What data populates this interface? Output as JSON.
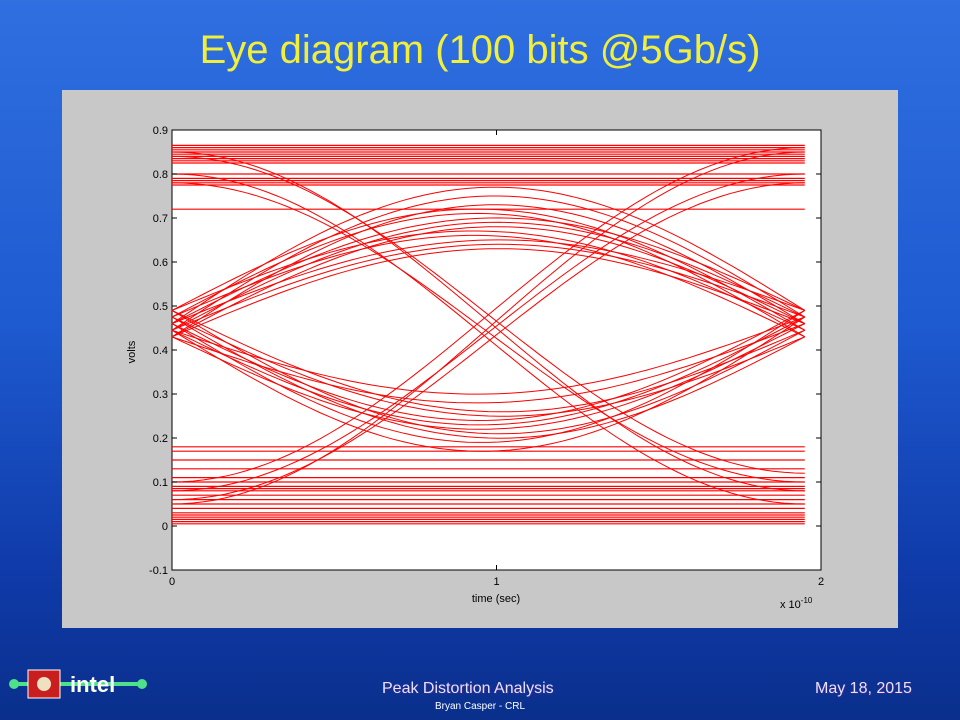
{
  "slide": {
    "title": "Eye diagram (100 bits @5Gb/s)",
    "footer_left": "Peak Distortion Analysis",
    "footer_right": "May 18, 2015",
    "author": "Bryan Casper - CRL",
    "logo_text": "intel"
  },
  "colors": {
    "title": "#f2ef3a",
    "trace": "#ff0000",
    "panel": "#c8c8c8"
  },
  "chart_data": {
    "type": "line",
    "title": "",
    "xlabel": "time (sec)",
    "ylabel": "volts",
    "x_exponent_label": "x 10",
    "x_exponent_power": "-10",
    "xlim": [
      0,
      2
    ],
    "ylim": [
      -0.1,
      0.9
    ],
    "xticks": [
      "0",
      "1",
      "2"
    ],
    "yticks": [
      "-0.1",
      "0",
      "0.1",
      "0.2",
      "0.3",
      "0.4",
      "0.5",
      "0.6",
      "0.7",
      "0.8",
      "0.9"
    ],
    "grid": false,
    "legend": "none",
    "series_color": "red",
    "x_end": 1.95,
    "crossing_level": 0.46,
    "eye_center_x": 1.0,
    "flat_high_levels": [
      0.72,
      0.775,
      0.78,
      0.785,
      0.79,
      0.8,
      0.825,
      0.83,
      0.835,
      0.84,
      0.845,
      0.85,
      0.855,
      0.86,
      0.865
    ],
    "flat_low_levels": [
      0.005,
      0.01,
      0.015,
      0.02,
      0.025,
      0.03,
      0.04,
      0.05,
      0.06,
      0.07,
      0.08,
      0.085,
      0.09,
      0.1,
      0.11,
      0.13,
      0.15,
      0.17,
      0.18
    ],
    "rising_peaks": [
      0.63,
      0.64,
      0.65,
      0.66,
      0.67,
      0.68,
      0.69,
      0.7,
      0.71,
      0.72,
      0.73,
      0.75,
      0.77
    ],
    "falling_troughs": [
      0.17,
      0.19,
      0.2,
      0.21,
      0.22,
      0.23,
      0.24,
      0.25,
      0.26,
      0.28,
      0.3
    ],
    "rising_cross_lines": [
      [
        0.05,
        0.85
      ],
      [
        0.08,
        0.8
      ],
      [
        0.1,
        0.86
      ],
      [
        0.06,
        0.78
      ]
    ],
    "falling_cross_lines": [
      [
        0.85,
        0.08
      ],
      [
        0.8,
        0.05
      ],
      [
        0.84,
        0.12
      ],
      [
        0.78,
        0.1
      ]
    ]
  }
}
